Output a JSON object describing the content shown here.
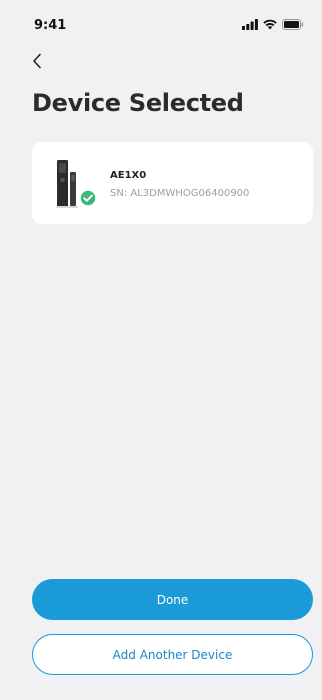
{
  "status_bar": {
    "time": "9:41",
    "icons": [
      "signal-icon",
      "wifi-icon",
      "battery-icon"
    ]
  },
  "nav": {
    "back_icon": "chevron-left-icon"
  },
  "page": {
    "title": "Device Selected"
  },
  "device": {
    "name": "AE1X0",
    "serial": "SN: AL3DMWHOG06400900",
    "status_icon": "check-circle-icon",
    "status_color": "#3cb878"
  },
  "actions": {
    "done_label": "Done",
    "add_label": "Add Another Device"
  },
  "colors": {
    "accent": "#1a9ad6",
    "background": "#f1f1f3",
    "card": "#ffffff"
  }
}
